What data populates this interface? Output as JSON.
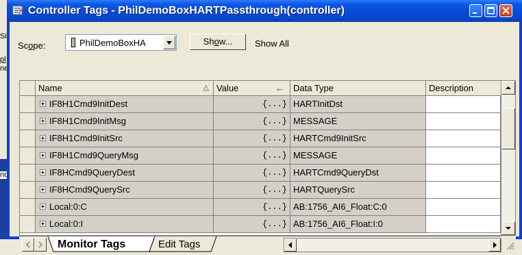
{
  "window": {
    "title": "Controller Tags - PhilDemoBoxHARTPassthrough(controller)"
  },
  "background": {
    "fragments": [
      "Si",
      "pl",
      "ne",
      "nd"
    ]
  },
  "toolbar": {
    "scope_label_prefix": "Sc",
    "scope_label_mnemonic": "o",
    "scope_label_suffix": "pe:",
    "scope_value": "PhilDemoBoxHA",
    "show_button_prefix": "Sh",
    "show_button_mnemonic": "o",
    "show_button_suffix": "w...",
    "show_filter": "Show All"
  },
  "table": {
    "headers": {
      "name": "Name",
      "name_sort": "△",
      "value": "Value",
      "value_arrow": "←",
      "data_type": "Data Type",
      "description": "Description"
    },
    "rows": [
      {
        "name": "IF8H1Cmd9InitDest",
        "value": "{...}",
        "type": "HARTInitDst"
      },
      {
        "name": "IF8H1Cmd9InitMsg",
        "value": "{...}",
        "type": "MESSAGE"
      },
      {
        "name": "IF8H1Cmd9InitSrc",
        "value": "{...}",
        "type": "HARTCmd9InitSrc"
      },
      {
        "name": "IF8H1Cmd9QueryMsg",
        "value": "{...}",
        "type": "MESSAGE"
      },
      {
        "name": "IF8HCmd9QueryDest",
        "value": "{...}",
        "type": "HARTCmd9QueryDst"
      },
      {
        "name": "IF8HCmd9QuerySrc",
        "value": "{...}",
        "type": "HARTQuerySrc"
      },
      {
        "name": "Local:0:C",
        "value": "{...}",
        "type": "AB:1756_AI6_Float:C:0"
      },
      {
        "name": "Local:0:I",
        "value": "{...}",
        "type": "AB:1756_AI6_Float:I:0"
      }
    ]
  },
  "tabs": {
    "monitor": "Monitor Tags",
    "edit": "Edit Tags"
  },
  "colors": {
    "titlebar": "#0a49d5",
    "cell_readonly": "#d4d0c8",
    "face": "#ece9d8"
  }
}
